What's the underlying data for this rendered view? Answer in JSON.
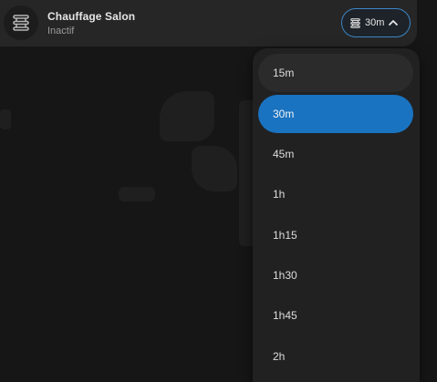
{
  "card": {
    "title": "Chauffage Salon",
    "status": "Inactif",
    "icon": "radiator-icon"
  },
  "select": {
    "value": "30m",
    "icon": "radiator-icon",
    "chevron": "chevron-up-icon",
    "accent": "#3d86c6"
  },
  "menu": {
    "selected": "30m",
    "selected_color": "#1a73c0",
    "options": [
      "15m",
      "30m",
      "45m",
      "1h",
      "1h15",
      "1h30",
      "1h45",
      "2h"
    ]
  }
}
